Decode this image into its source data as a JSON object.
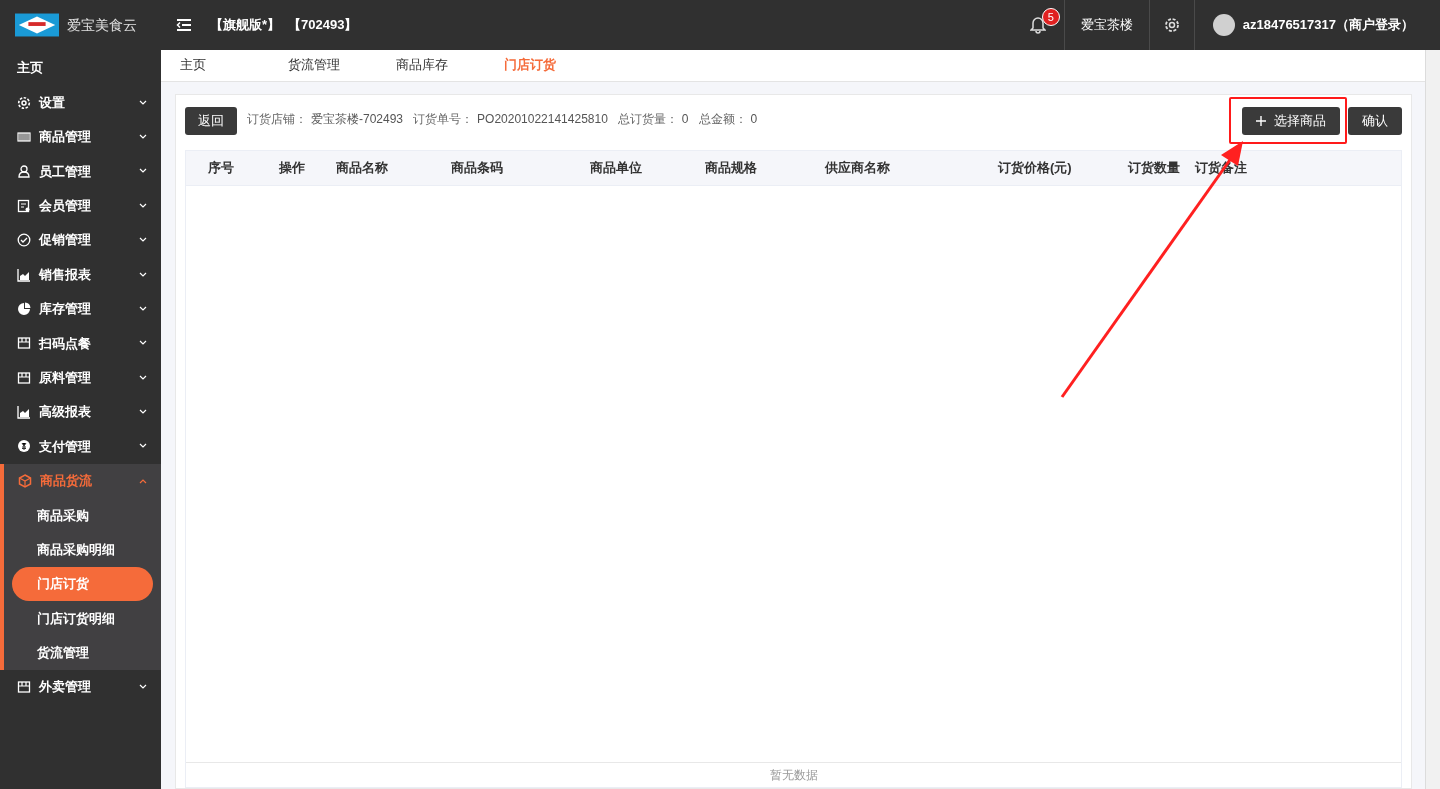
{
  "header": {
    "brand": "爱宝美食云",
    "edition": "【旗舰版*】",
    "store_code": "【702493】",
    "notification_count": "5",
    "store_name": "爱宝茶楼",
    "account": "az18476517317（商户登录）"
  },
  "sidebar": {
    "items": [
      {
        "label": "主页",
        "kind": "link",
        "selected": false
      },
      {
        "label": "设置",
        "kind": "group",
        "selected": false,
        "expanded": false
      },
      {
        "label": "商品管理",
        "kind": "group",
        "selected": false,
        "expanded": false
      },
      {
        "label": "员工管理",
        "kind": "group",
        "selected": false,
        "expanded": false
      },
      {
        "label": "会员管理",
        "kind": "group",
        "selected": false,
        "expanded": false
      },
      {
        "label": "促销管理",
        "kind": "group",
        "selected": false,
        "expanded": false
      },
      {
        "label": "销售报表",
        "kind": "group",
        "selected": false,
        "expanded": false
      },
      {
        "label": "库存管理",
        "kind": "group",
        "selected": false,
        "expanded": false
      },
      {
        "label": "扫码点餐",
        "kind": "group",
        "selected": false,
        "expanded": false
      },
      {
        "label": "原料管理",
        "kind": "group",
        "selected": false,
        "expanded": false
      },
      {
        "label": "高级报表",
        "kind": "group",
        "selected": false,
        "expanded": false
      },
      {
        "label": "支付管理",
        "kind": "group",
        "selected": false,
        "expanded": false
      },
      {
        "label": "商品货流",
        "kind": "group",
        "selected": true,
        "expanded": true,
        "children": [
          {
            "label": "商品采购",
            "selected": false
          },
          {
            "label": "商品采购明细",
            "selected": false
          },
          {
            "label": "门店订货",
            "selected": true
          },
          {
            "label": "门店订货明细",
            "selected": false
          },
          {
            "label": "货流管理",
            "selected": false
          }
        ]
      },
      {
        "label": "外卖管理",
        "kind": "group",
        "selected": false,
        "expanded": false
      }
    ]
  },
  "tabs": [
    {
      "label": "主页",
      "selected": false
    },
    {
      "label": "货流管理",
      "selected": false
    },
    {
      "label": "商品库存",
      "selected": false
    },
    {
      "label": "门店订货",
      "selected": true
    }
  ],
  "toolbar": {
    "back_button": "返回",
    "fields": [
      {
        "label": "订货店铺：",
        "value": "爱宝茶楼-702493"
      },
      {
        "label": "订货单号：",
        "value": "PO20201022141425810"
      },
      {
        "label": "总订货量：",
        "value": "0"
      },
      {
        "label": "总金额：",
        "value": "0"
      }
    ],
    "select_button": "选择商品",
    "confirm_button": "确认"
  },
  "table": {
    "columns": [
      "序号",
      "操作",
      "商品名称",
      "商品条码",
      "商品单位",
      "商品规格",
      "供应商名称",
      "订货价格(元)",
      "订货数量",
      "订货备注"
    ],
    "empty_text": "暂无数据"
  }
}
